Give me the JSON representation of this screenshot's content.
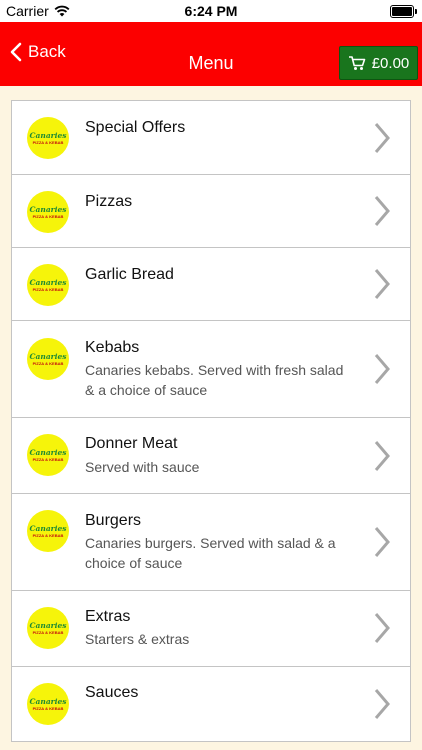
{
  "status_bar": {
    "carrier": "Carrier",
    "time": "6:24 PM"
  },
  "nav": {
    "back_label": "Back",
    "title": "Menu",
    "cart_total": "£0.00"
  },
  "logo": {
    "line1": "Canaries",
    "line2": "PIZZA & KEBAB"
  },
  "menu_items": [
    {
      "title": "Special Offers",
      "description": ""
    },
    {
      "title": "Pizzas",
      "description": ""
    },
    {
      "title": "Garlic Bread",
      "description": ""
    },
    {
      "title": "Kebabs",
      "description": "Canaries kebabs. Served with fresh salad & a choice of sauce"
    },
    {
      "title": "Donner Meat",
      "description": "Served with sauce"
    },
    {
      "title": "Burgers",
      "description": "Canaries burgers. Served with salad & a choice of sauce"
    },
    {
      "title": "Extras",
      "description": "Starters & extras"
    },
    {
      "title": "Sauces",
      "description": ""
    }
  ],
  "colors": {
    "nav_bar": "#fc0000",
    "cart_button": "#19751d",
    "page_background": "#fdf5e1",
    "logo_yellow": "#f6f40a",
    "logo_green": "#1e8a34"
  }
}
